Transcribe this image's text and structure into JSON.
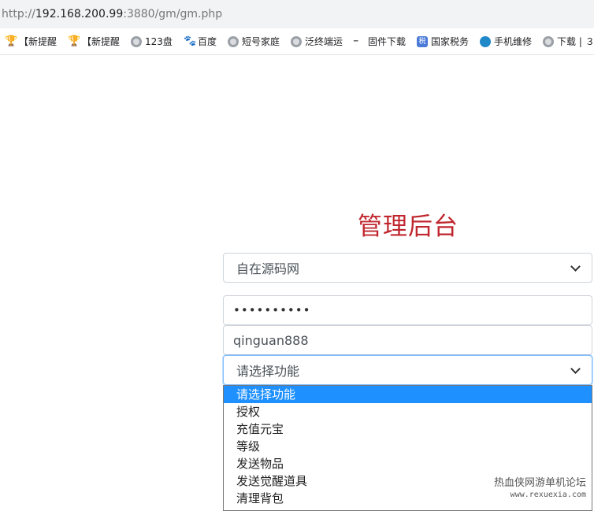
{
  "browser": {
    "url_scheme": "http://",
    "url_host": "192.168.200.99",
    "url_rest": ":3880/gm/gm.php"
  },
  "bookmarks": [
    {
      "icon": "trophy-icon",
      "label": "【新提醒"
    },
    {
      "icon": "trophy-icon",
      "label": "【新提醒"
    },
    {
      "icon": "globe-icon",
      "label": "123盘"
    },
    {
      "icon": "baidu-paw-icon",
      "label": "百度"
    },
    {
      "icon": "globe-icon",
      "label": "短号家庭"
    },
    {
      "icon": "globe-icon",
      "label": "泛终端运"
    },
    {
      "icon": "firmware-icon",
      "label": "固件下载"
    },
    {
      "icon": "tax-icon",
      "label": "国家税务"
    },
    {
      "icon": "phone-repair-icon",
      "label": "手机维修"
    },
    {
      "icon": "globe-icon",
      "label": "下载 | ３"
    }
  ],
  "page": {
    "title": "管理后台",
    "server_select": "自在源码网",
    "password_mask": "••••••••••",
    "account": "qinguan888",
    "function_select": "请选择功能"
  },
  "dropdown_options": [
    {
      "label": "请选择功能",
      "selected": true
    },
    {
      "label": "授权",
      "selected": false
    },
    {
      "label": "充值元宝",
      "selected": false
    },
    {
      "label": "等级",
      "selected": false
    },
    {
      "label": "发送物品",
      "selected": false
    },
    {
      "label": "发送觉醒道具",
      "selected": false
    },
    {
      "label": "清理背包",
      "selected": false
    }
  ],
  "watermark": {
    "line1": "热血侠网游单机论坛",
    "line2": "www.rexuexia.com"
  },
  "colors": {
    "title": "#c0262d",
    "option_highlight": "#1e90ff"
  }
}
